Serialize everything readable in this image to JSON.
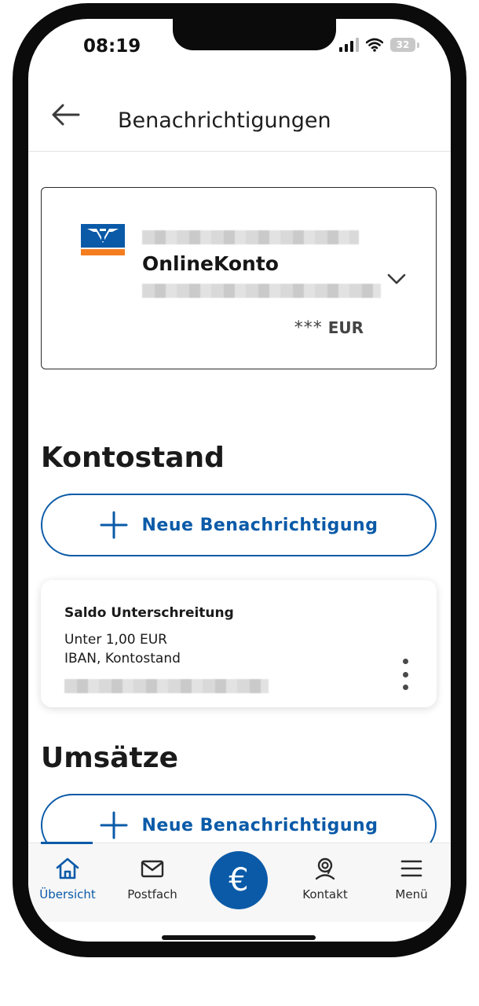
{
  "status_bar": {
    "time": "08:19",
    "battery": "32"
  },
  "app_bar": {
    "title": "Benachrichtigungen"
  },
  "account": {
    "name": "OnlineKonto",
    "balance_masked": "***",
    "currency": "EUR"
  },
  "sections": [
    {
      "title": "Kontostand",
      "button_label": "Neue Benachrichtigung"
    },
    {
      "title": "Umsätze",
      "button_label": "Neue Benachrichtigung"
    }
  ],
  "alert": {
    "title": "Saldo Unterschreitung",
    "line1": "Unter 1,00 EUR",
    "line2": "IBAN, Kontostand"
  },
  "bottom_nav": {
    "items": [
      {
        "label": "Übersicht",
        "icon": "home-icon",
        "active": true
      },
      {
        "label": "Postfach",
        "icon": "mail-icon",
        "active": false
      },
      {
        "label": "€",
        "icon": "euro-icon",
        "active": false
      },
      {
        "label": "Kontakt",
        "icon": "contact-icon",
        "active": false
      },
      {
        "label": "Menü",
        "icon": "menu-icon",
        "active": false
      }
    ]
  },
  "colors": {
    "accent": "#0a5aa8",
    "logo_orange": "#f47d20",
    "text": "#1a1a1a"
  }
}
